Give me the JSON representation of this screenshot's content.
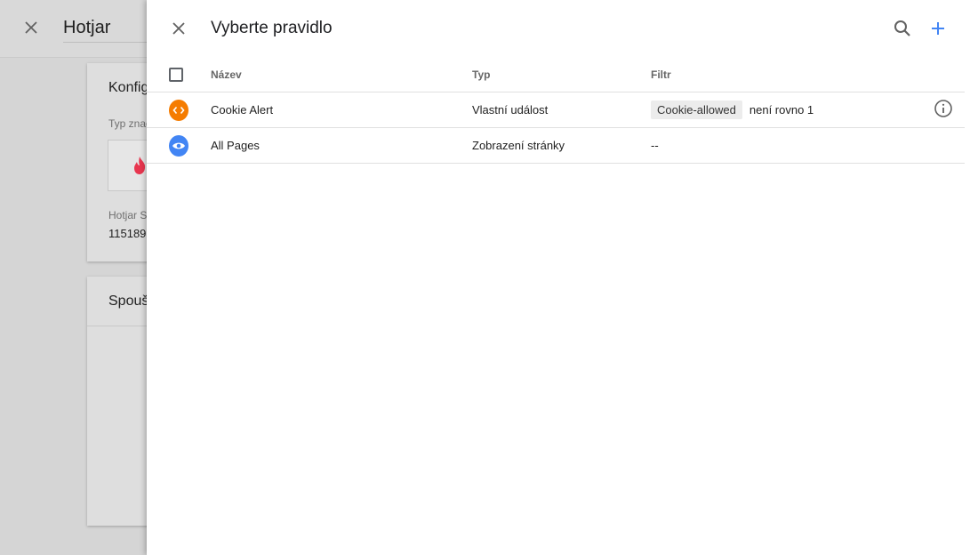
{
  "background": {
    "title": "Hotjar",
    "config_card": {
      "heading": "Konfig",
      "tag_type_label": "Typ znač",
      "site_id_label": "Hotjar S",
      "site_id_value": "115189"
    },
    "trigger_card": {
      "heading": "Spouš"
    }
  },
  "panel": {
    "title": "Vyberte pravidlo",
    "accent_color": "#4285f4",
    "table": {
      "headers": {
        "name": "Název",
        "type": "Typ",
        "filter": "Filtr"
      },
      "rows": [
        {
          "icon": "custom-event-icon",
          "icon_color": "#f57c00",
          "name": "Cookie Alert",
          "type": "Vlastní událost",
          "filter_chip": "Cookie-allowed",
          "filter_op": "není rovno 1",
          "has_info": true
        },
        {
          "icon": "page-view-icon",
          "icon_color": "#4285f4",
          "name": "All Pages",
          "type": "Zobrazení stránky",
          "filter_text": "--"
        }
      ]
    }
  }
}
